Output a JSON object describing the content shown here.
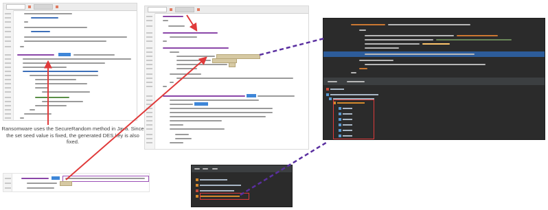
{
  "caption": "Ransomware uses the SecureRandom method in Java. Since the set seed value is fixed, the generated DES key is also fixed.",
  "colors": {
    "red_arrow": "#e03a3a",
    "purple_dash": "#5a2fa0",
    "highlight_blue": "#3e86d8",
    "highlight_tan": "#d6c9a3",
    "ide_dark": "#2b2b2b"
  },
  "icons": [
    "red-arrow",
    "purple-dashed-connector",
    "close-tab-icon",
    "folder-icon",
    "file-icon"
  ]
}
